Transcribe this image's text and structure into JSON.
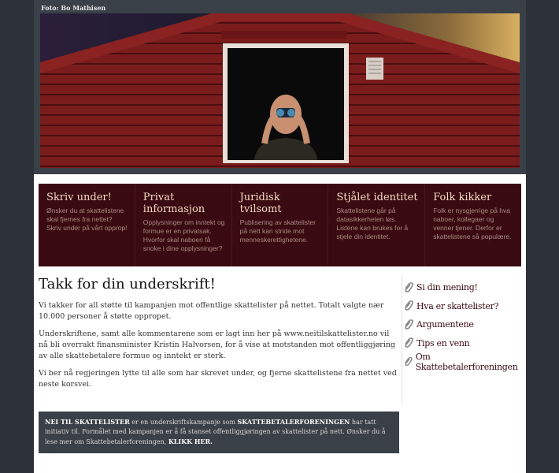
{
  "header": {
    "photo_credit": "Foto: Bo Mathisen"
  },
  "nav": {
    "items": [
      {
        "title": "Skriv under!",
        "desc": "Ønsker du at skattelistene skal fjernes fra nettet? Skriv under på vårt opprop!"
      },
      {
        "title": "Privat informasjon",
        "desc": "Opplysninger om inntekt og formue er en privatsak. Hvorfor skal naboen få snoke i dine opplysninger?"
      },
      {
        "title": "Juridisk tvilsomt",
        "desc": "Publisering av skattelister på nett kan stride mot menneskerettighetene."
      },
      {
        "title": "Stjålet identitet",
        "desc": "Skattelistene går på datasikkerheten løs. Listene kan brukes for å stjele din identitet."
      },
      {
        "title": "Folk kikker",
        "desc": "Folk er nysgjerrige på hva naboer, kollegaer og venner tjener. Derfor er skattelistene så populære."
      }
    ]
  },
  "main": {
    "heading": "Takk for din underskrift!",
    "paragraphs": [
      "Vi takker for all støtte til kampanjen mot offentlige skattelister på nettet. Totalt valgte nær 10.000 personer å støtte oppropet.",
      "Underskriftene, samt alle kommentarene som er lagt inn her på www.neitilskattelister.no vil nå bli overrakt finansminister Kristin Halvorsen, for å vise at motstanden mot offentliggjøring av alle skattebetalere formue og inntekt er sterk.",
      "Vi ber nå regjeringen lytte til alle som har skrevet under, og fjerne skattelistene fra nettet ved neste korsvei."
    ]
  },
  "sidebar": {
    "items": [
      {
        "label": "Si din mening!",
        "icon": "paperclip-icon"
      },
      {
        "label": "Hva er skattelister?",
        "icon": "paperclip-icon"
      },
      {
        "label": "Argumentene",
        "icon": "paperclip-icon"
      },
      {
        "label": "Tips en venn",
        "icon": "paperclip-icon"
      },
      {
        "label": "Om Skattebetalerforeningen",
        "icon": "paperclip-icon"
      }
    ]
  },
  "footer": {
    "campaign_name": "NEI TIL SKATTELISTER",
    "text_1": " er en underskriftskampanje som ",
    "org_name": "SKATTEBETALERFORENINGEN",
    "text_2": " har tatt initiativ til. Formålet med kampanjen er å få stanset offentliggjøringen av skattelister på nett. Ønsker du å lese mer om Skattebetalerforeningen, ",
    "link": "KLIKK HER."
  },
  "colors": {
    "nav_bg": "#3a0a12",
    "nav_title": "#f3d9c0",
    "nav_desc": "#a88a80",
    "footer_bg": "#3a4048",
    "sidebar_link": "#3a0a12"
  }
}
